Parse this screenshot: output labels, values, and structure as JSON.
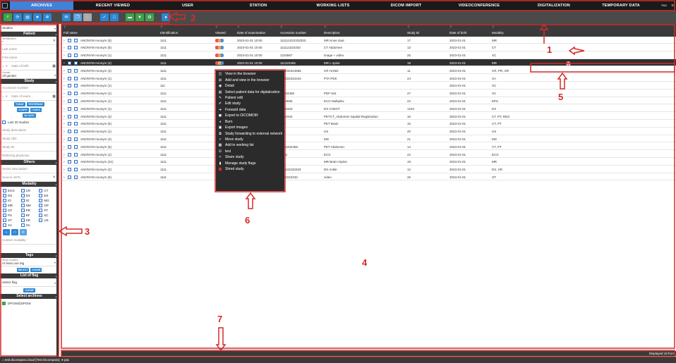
{
  "nav": {
    "tabs": [
      "ARCHIVES",
      "RECENT VIEWED",
      "USER",
      "STATION",
      "WORKING LISTS",
      "DICOM IMPORT",
      "VIDEOCONFERENCE",
      "DIGITALIZATION",
      "TEMPORARY DATA"
    ],
    "active_tab": "ARCHIVES",
    "right_label": "PAC"
  },
  "sidebar": {
    "view_select": "Studies",
    "patient_header": "Patient",
    "identification_small": "Identification",
    "identification_value": "*",
    "last_name": "Last name",
    "first_name": "First name",
    "date_of_birth": "Date of birth",
    "gender_small": "Gender",
    "gender_value": "All gender",
    "study_header": "Study",
    "accession_number": "Accession number",
    "date_of_exam": "Date of exam...",
    "quick_today": "TODAY",
    "quick_yesterday": "YESTERDAY",
    "quick_3days": "3 DAYS",
    "quick_7days": "7 DAYS",
    "quick_30days": "30 DAYS",
    "last30": "Last 30 studies",
    "study_description": "Study description",
    "study_uid": "Study UID",
    "study_id": "Study ID",
    "referring_physician": "Referring physician",
    "others_header": "Others",
    "series_description": "Series description",
    "source_aets": "Source AETs",
    "modality_header": "Modality",
    "modalities": [
      "ECG",
      "CR",
      "CT",
      "DS",
      "DX",
      "ES",
      "IO",
      "IO",
      "MG",
      "MR",
      "NM",
      "OP",
      "OT",
      "PR",
      "PT",
      "PX",
      "RF",
      "SC",
      "ST",
      "SR",
      "US",
      "XA",
      "XC"
    ],
    "custom_modality": "Custom modality",
    "tags_header": "Tags",
    "tags_small": "Study contains",
    "tags_value": "At least one tag",
    "tags_select": "SELECT",
    "tags_clear": "CLEAR",
    "flag_header": "List of flag",
    "flag_select": "Select flag",
    "flag_clear": "CLEAR",
    "archives_header": "Select archives",
    "archive_item": "DPOW@DPOW"
  },
  "table": {
    "columns": [
      "Full name",
      "Identification",
      "Viewed",
      "Date of examination",
      "Accession number",
      "Description",
      "Study ID",
      "Date of birth",
      "Modality"
    ],
    "rows": [
      {
        "name": "ANONYM Anonym (5)",
        "id": "1111",
        "viewed": true,
        "date": "2023-01-01 10:00",
        "acc": "111112222333333",
        "desc": "MR Knee dual",
        "sid": "17",
        "dob": "2023-01-01",
        "mod": "MR"
      },
      {
        "name": "ANONYM Anonym (5)",
        "id": "1111",
        "viewed": true,
        "date": "2023-01-01 10:00",
        "acc": "111112223333",
        "desc": "CT Abdomen",
        "sid": "13",
        "dob": "2023-01-01",
        "mod": "CT"
      },
      {
        "name": "ANONYM Anonym (1)",
        "id": "1111",
        "viewed": true,
        "date": "2023-01-01 10:00",
        "acc": "1234567",
        "desc": "image + video",
        "sid": "25",
        "dob": "2023-01-01",
        "mod": "XC"
      },
      {
        "name": "ANONYM Anonym (4)",
        "id": "1111",
        "viewed": true,
        "date": "2022-01-01 10:00",
        "acc": "111223455",
        "desc": "MR L spine",
        "sid": "18",
        "dob": "2023-01-01",
        "mod": "MR"
      },
      {
        "name": "ANONYM Anonym (4)",
        "id": "1111",
        "viewed": false,
        "date": "",
        "acc": "112233444555",
        "desc": "CR HAND",
        "sid": "11",
        "dob": "2023-01-01",
        "mod": "CR, PR, SR"
      },
      {
        "name": "ANONYM Anonym (1)",
        "id": "1111",
        "viewed": false,
        "date": "",
        "acc": "112222334444",
        "desc": "PTA PDK",
        "sid": "24",
        "dob": "2023-01-01",
        "mod": "XA"
      },
      {
        "name": "ANONYM Anonym (1)",
        "id": "111",
        "viewed": false,
        "date": "",
        "acc": "",
        "desc": "",
        "sid": "",
        "dob": "2024-01-01",
        "mod": "XC"
      },
      {
        "name": "ANONYM Anonym (1)",
        "id": "1111",
        "viewed": false,
        "date": "",
        "acc": "12334456",
        "desc": "PDF test",
        "sid": "27",
        "dob": "2023-01-01",
        "mod": "XC"
      },
      {
        "name": "ANONYM Anonym (1)",
        "id": "1111",
        "viewed": false,
        "date": "",
        "acc": "1234555",
        "desc": "ECG Multiplex",
        "sid": "22",
        "dob": "2023-01-01",
        "mod": "EPS"
      },
      {
        "name": "ANONYM Anonym (1)",
        "id": "1111",
        "viewed": false,
        "date": "",
        "acc": "1222333",
        "desc": "DX CHEST",
        "sid": "1234",
        "dob": "2023-01-01",
        "mod": "DX"
      },
      {
        "name": "ANONYM Anonym (3)",
        "id": "1111",
        "viewed": false,
        "date": "",
        "acc": "1222344",
        "desc": "PETCT_Abdomen Spatial Registration",
        "sid": "16",
        "dob": "2023-01-01",
        "mod": "CT, PT, REG"
      },
      {
        "name": "ANONYM Anonym (5)",
        "id": "1111",
        "viewed": false,
        "date": "",
        "acc": "345",
        "desc": "PET Brain",
        "sid": "15",
        "dob": "2023-01-01",
        "mod": "CT, PT"
      },
      {
        "name": "ANONYM Anonym (1)",
        "id": "1111",
        "viewed": false,
        "date": "",
        "acc": "456",
        "desc": "US",
        "sid": "20",
        "dob": "2023-01-01",
        "mod": "US"
      },
      {
        "name": "ANONYM Anonym (4)",
        "id": "1111",
        "viewed": false,
        "date": "",
        "acc": "55",
        "desc": "MG",
        "sid": "21",
        "dob": "2023-01-01",
        "mod": "MG"
      },
      {
        "name": "ANONYM Anonym (5)",
        "id": "1111",
        "viewed": false,
        "date": "",
        "acc": "1222334455",
        "desc": "PET Abdomen",
        "sid": "14",
        "dob": "2023-01-01",
        "mod": "CT, PT"
      },
      {
        "name": "ANONYM Anonym (1)",
        "id": "1111",
        "viewed": false,
        "date": "",
        "acc": "1233",
        "desc": "ECG",
        "sid": "22",
        "dob": "2023-01-01",
        "mod": "ECG"
      },
      {
        "name": "ANONYM Anonym (21)",
        "id": "1111",
        "viewed": false,
        "date": "",
        "acc": "33",
        "desc": "MR Brain+Spine",
        "sid": "19",
        "dob": "2023-01-01",
        "mod": "MR"
      },
      {
        "name": "ANONYM Anonym (2)",
        "id": "1111",
        "viewed": false,
        "date": "",
        "acc": "111222233333",
        "desc": "DX Ankle",
        "sid": "12",
        "dob": "2023-01-01",
        "mod": "DX, SR"
      },
      {
        "name": "ANONYM Anonym (5)",
        "id": "1111",
        "viewed": false,
        "date": "",
        "acc": "1122223333",
        "desc": "video",
        "sid": "26",
        "dob": "2023-01-01",
        "mod": "OT"
      }
    ],
    "highlighted_row": 3,
    "displayed_count": "Displayed 19 from"
  },
  "context_menu": [
    {
      "icon": "browser-icon",
      "label": "View in the browser"
    },
    {
      "icon": "add-view-icon",
      "label": "Add and view in the browser"
    },
    {
      "icon": "eye-icon",
      "label": "Detail"
    },
    {
      "icon": "digitalize-icon",
      "label": "Select patient data for digitalization"
    },
    {
      "icon": "pencil-icon",
      "label": "Patient edit"
    },
    {
      "icon": "edit-study-icon",
      "label": "Edit study"
    },
    {
      "icon": "arrow-icon",
      "label": "Forward data"
    },
    {
      "icon": "export-icon",
      "label": "Export to DICOMDIR"
    },
    {
      "icon": "burn-icon",
      "label": "Burn"
    },
    {
      "icon": "images-icon",
      "label": "Export images"
    },
    {
      "icon": "network-icon",
      "label": "Study forwarding to external network"
    },
    {
      "icon": "move-icon",
      "label": "Move study"
    },
    {
      "icon": "list-icon",
      "label": "Add to working list"
    },
    {
      "icon": "test-icon",
      "label": "test"
    },
    {
      "icon": "share-icon",
      "label": "Share study"
    },
    {
      "icon": "flag-icon",
      "label": "Manage study flags"
    },
    {
      "icon": "trash-icon",
      "label": "Shred study"
    }
  ],
  "footer": {
    "host": "test.dicompass.cloud [Test Dicompass]",
    "user": "pac"
  },
  "callouts": [
    "1",
    "2",
    "3",
    "4",
    "5",
    "6",
    "7"
  ],
  "colors": {
    "accent": "#3f82d6",
    "callout": "#d42a2a",
    "dark": "#3a3a3a"
  }
}
